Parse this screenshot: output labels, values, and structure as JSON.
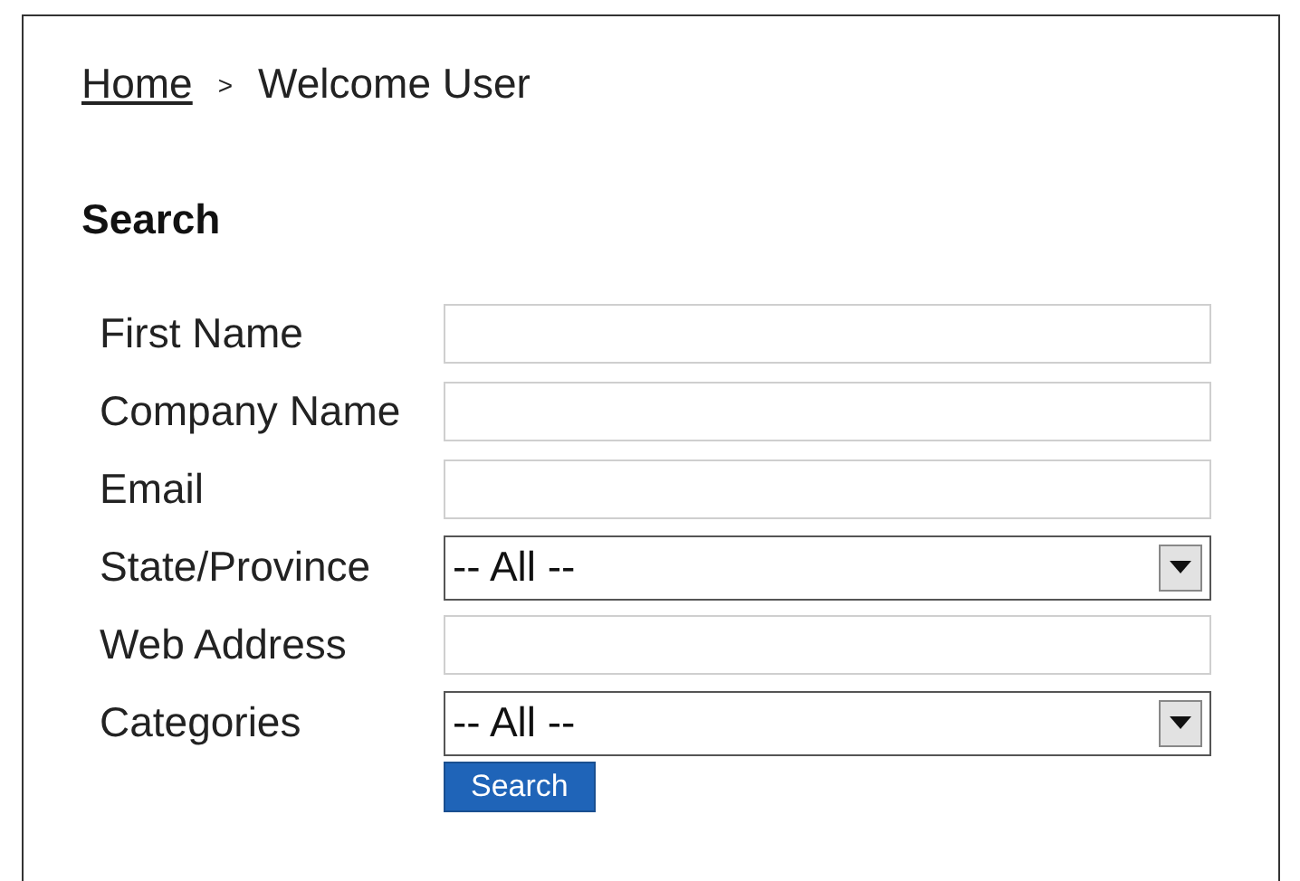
{
  "breadcrumb": {
    "link": "Home",
    "separator": ">",
    "current": "Welcome User"
  },
  "heading": "Search",
  "fields": [
    {
      "label": "First Name",
      "kind": "text"
    },
    {
      "label": "Company Name",
      "kind": "text"
    },
    {
      "label": "Email",
      "kind": "text"
    },
    {
      "label": "State/Province",
      "kind": "select",
      "value": "-- All --"
    },
    {
      "label": "Web Address",
      "kind": "text"
    },
    {
      "label": "Categories",
      "kind": "select",
      "value": "-- All --"
    }
  ],
  "button": "Search"
}
